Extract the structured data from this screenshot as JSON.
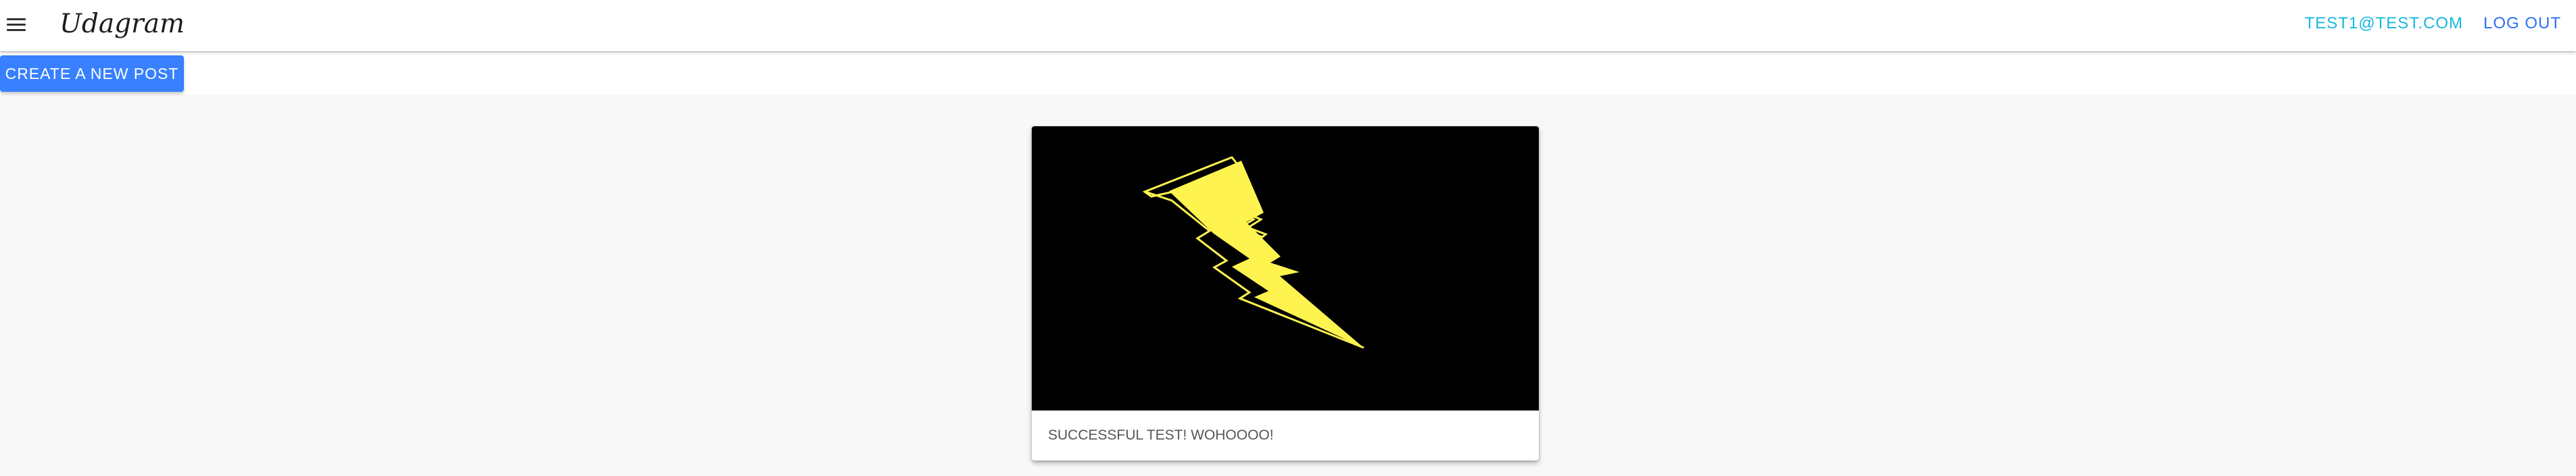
{
  "header": {
    "title": "Udagram",
    "menu_icon": "menu-icon",
    "user_email": "TEST1@TEST.COM",
    "logout_label": "LOG OUT",
    "email_color": "#16b8df",
    "logout_color": "#2f6ff2"
  },
  "actions": {
    "create_post_label": "CREATE A NEW POST",
    "create_post_color": "#3880ff"
  },
  "feed": {
    "posts": [
      {
        "image_name": "lightning-bolt-image",
        "image_background": "#000000",
        "bolt_fill": "#fff44f",
        "caption": "SUCCESSFUL TEST! WOHOOOO!"
      }
    ]
  }
}
